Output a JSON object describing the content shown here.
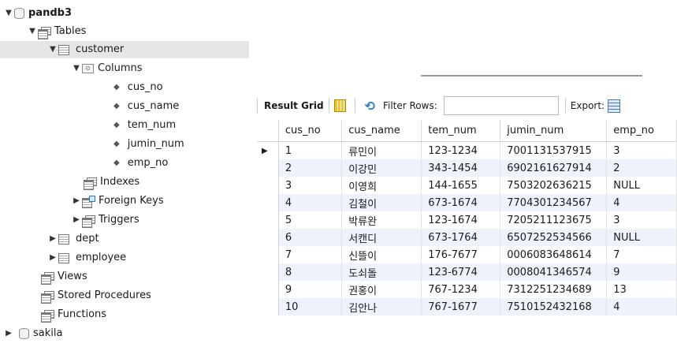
{
  "navigator": {
    "schema_name": "pandb3",
    "tables_label": "Tables",
    "selected_table": "customer",
    "columns_label": "Columns",
    "columns": [
      "cus_no",
      "cus_name",
      "tem_num",
      "jumin_num",
      "emp_no"
    ],
    "indexes_label": "Indexes",
    "foreign_keys_label": "Foreign Keys",
    "triggers_label": "Triggers",
    "other_tables": [
      "dept",
      "employee"
    ],
    "views_label": "Views",
    "procedures_label": "Stored Procedures",
    "functions_label": "Functions",
    "other_schema": "sakila"
  },
  "toolbar": {
    "result_grid_label": "Result Grid",
    "filter_label": "Filter Rows:",
    "filter_value": "",
    "export_label": "Export:"
  },
  "grid": {
    "headers": [
      "cus_no",
      "cus_name",
      "tem_num",
      "jumin_num",
      "emp_no"
    ],
    "rows": [
      [
        "1",
        "류민이",
        "123-1234",
        "7001131537915",
        "3"
      ],
      [
        "2",
        "이강민",
        "343-1454",
        "6902161627914",
        "2"
      ],
      [
        "3",
        "이영희",
        "144-1655",
        "7503202636215",
        "NULL"
      ],
      [
        "4",
        "김철이",
        "673-1674",
        "7704301234567",
        "4"
      ],
      [
        "5",
        "박류완",
        "123-1674",
        "7205211123675",
        "3"
      ],
      [
        "6",
        "서캔디",
        "673-1764",
        "6507252534566",
        "NULL"
      ],
      [
        "7",
        "신뜰이",
        "176-7677",
        "0006083648614",
        "7"
      ],
      [
        "8",
        "도쇠돌",
        "123-6774",
        "0008041346574",
        "9"
      ],
      [
        "9",
        "권홍이",
        "767-1234",
        "7312251234689",
        "13"
      ],
      [
        "10",
        "김안나",
        "767-1677",
        "7510152432168",
        "4"
      ]
    ]
  }
}
